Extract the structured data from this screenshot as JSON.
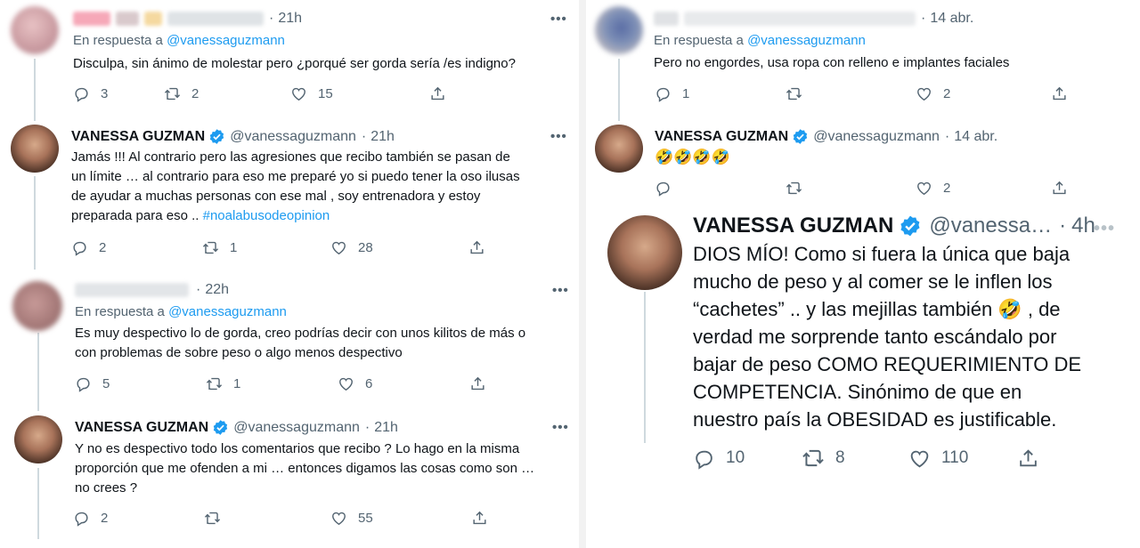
{
  "left": {
    "t1": {
      "time": "21h",
      "reply_label": "En respuesta a",
      "reply_handle": "@vanessaguzmann",
      "text": "Disculpa, sin ánimo de molestar pero ¿porqué ser gorda sería /es indigno?",
      "replies": "3",
      "retweets": "2",
      "likes": "15"
    },
    "t2": {
      "name": "VANESSA GUZMAN",
      "handle": "@vanessaguzmann",
      "time": "21h",
      "text": "Jamás !!! Al contrario pero las agresiones que recibo  también se pasan de\nun límite … al contrario para eso me preparé yo si puedo tener la oso ilusas\nde ayudar a muchas personas con ese mal , soy entrenadora y estoy\npreparada para eso .. ",
      "hashtag": "#noalabusodeopinion",
      "replies": "2",
      "retweets": "1",
      "likes": "28"
    },
    "t3": {
      "time": "22h",
      "reply_label": "En respuesta a",
      "reply_handle": "@vanessaguzmann",
      "text": "Es muy despectivo lo de gorda, creo podrías decir con unos kilitos de más o\ncon problemas de sobre peso o algo menos despectivo",
      "replies": "5",
      "retweets": "1",
      "likes": "6"
    },
    "t4": {
      "name": "VANESSA GUZMAN",
      "handle": "@vanessaguzmann",
      "time": "21h",
      "text": "Y no es despectivo todo los comentarios que recibo ? Lo hago en la misma\nproporción que me ofenden a mi … entonces digamos las cosas como son …\nno crees ?",
      "replies": "2",
      "retweets": "",
      "likes": "55"
    }
  },
  "right": {
    "t1": {
      "time": "14 abr.",
      "reply_label": "En respuesta a",
      "reply_handle": "@vanessaguzmann",
      "text": "Pero no engordes, usa ropa con relleno e implantes faciales",
      "replies": "1",
      "retweets": "",
      "likes": "2"
    },
    "t2": {
      "name": "VANESSA GUZMAN",
      "handle": "@vanessaguzmann",
      "time": "14 abr.",
      "text": "🤣🤣🤣🤣",
      "replies": "",
      "retweets": "",
      "likes": "2"
    },
    "t3": {
      "name": "VANESSA GUZMAN",
      "handle": "@vanessa…",
      "time": "4h",
      "text": "DIOS MÍO! Como si fuera la única que baja\nmucho de peso y al comer se le inflen los\n“cachetes” .. y las mejillas también 🤣 , de\nverdad me sorprende tanto escándalo por\nbajar de peso COMO REQUERIMIENTO DE\nCOMPETENCIA. Sinónimo de que en\nnuestro país la OBESIDAD es justificable.",
      "replies": "10",
      "retweets": "8",
      "likes": "110"
    }
  },
  "common": {
    "dot": "·",
    "more": "•••"
  },
  "icons": {
    "reply": "reply-icon",
    "retweet": "retweet-icon",
    "like": "heart-icon",
    "share": "share-icon",
    "verified": "verified-badge-icon"
  },
  "colors": {
    "link": "#1d9bf0",
    "secondary_text": "#536471",
    "thread_line": "#cfd9de"
  }
}
